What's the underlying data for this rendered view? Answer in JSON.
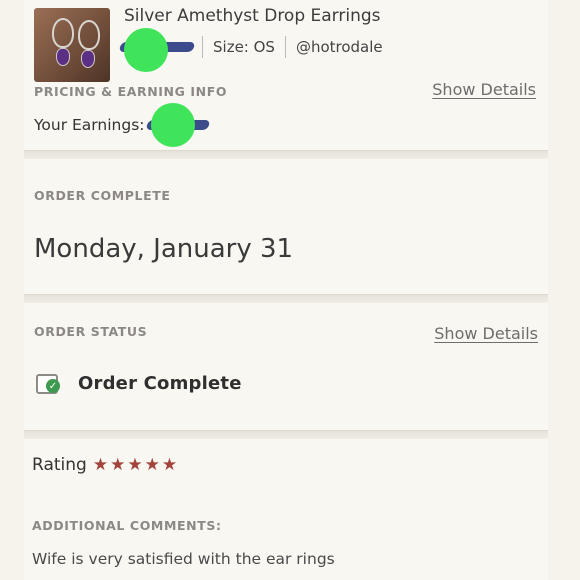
{
  "product": {
    "title": "Silver Amethyst Drop Earrings",
    "size_label": "Size: OS",
    "seller": "@hotrodale"
  },
  "pricing": {
    "section_label": "PRICING & EARNING INFO",
    "show_details": "Show Details",
    "earnings_label": "Your Earnings:"
  },
  "order_complete": {
    "section_label": "ORDER COMPLETE",
    "date": "Monday, January 31"
  },
  "order_status": {
    "section_label": "ORDER STATUS",
    "show_details": "Show Details",
    "status": "Order Complete"
  },
  "rating": {
    "label": "Rating",
    "stars": 5,
    "star_color": "#a2443c"
  },
  "comments": {
    "section_label": "ADDITIONAL COMMENTS:",
    "text": "Wife is very satisfied with the ear rings"
  },
  "colors": {
    "redaction_green": "#3fe45a",
    "redaction_blue": "#3b4b8c",
    "check_green": "#3d9a4f"
  },
  "icons": {
    "status": "order-complete-check-icon",
    "star": "star-icon"
  }
}
